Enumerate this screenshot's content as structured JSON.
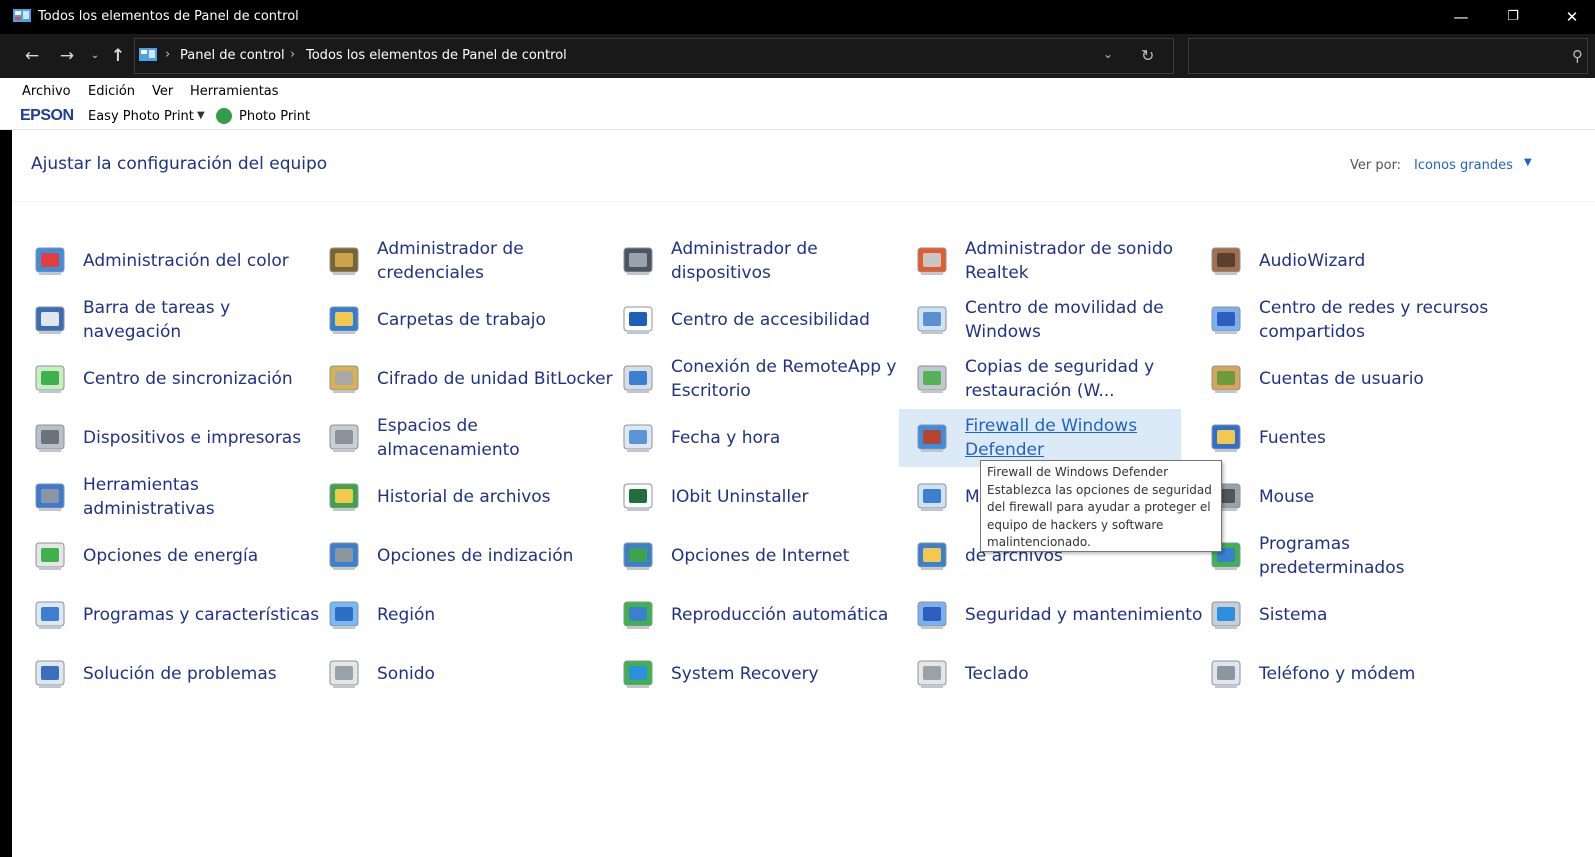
{
  "window": {
    "title": "Todos los elementos de Panel de control",
    "minimize_label": "—",
    "restore_label": "❐",
    "close_label": "✕"
  },
  "address": {
    "breadcrumbs": [
      "Panel de control",
      "Todos los elementos de Panel de control"
    ]
  },
  "menu": [
    "Archivo",
    "Edición",
    "Ver",
    "Herramientas"
  ],
  "epson": {
    "logo": "EPSON",
    "app": "Easy Photo Print",
    "photo_print": "Photo Print"
  },
  "header": {
    "title": "Ajustar la configuración del equipo",
    "view_by_label": "Ver por:",
    "view_by_value": "Iconos grandes"
  },
  "items": [
    {
      "label": "Administración del color",
      "icon": "color-management-icon"
    },
    {
      "label": "Administrador de credenciales",
      "icon": "credential-manager-icon"
    },
    {
      "label": "Administrador de dispositivos",
      "icon": "device-manager-icon"
    },
    {
      "label": "Administrador de sonido Realtek",
      "icon": "speaker-icon"
    },
    {
      "label": "AudioWizard",
      "icon": "audiowizard-icon"
    },
    {
      "label": "Barra de tareas y navegación",
      "icon": "taskbar-icon"
    },
    {
      "label": "Carpetas de trabajo",
      "icon": "work-folders-icon"
    },
    {
      "label": "Centro de accesibilidad",
      "icon": "accessibility-icon"
    },
    {
      "label": "Centro de movilidad de Windows",
      "icon": "mobility-center-icon"
    },
    {
      "label": "Centro de redes y recursos compartidos",
      "icon": "network-center-icon"
    },
    {
      "label": "Centro de sincronización",
      "icon": "sync-center-icon"
    },
    {
      "label": "Cifrado de unidad BitLocker",
      "icon": "bitlocker-icon"
    },
    {
      "label": "Conexión de RemoteApp y Escritorio",
      "icon": "remoteapp-icon"
    },
    {
      "label": "Copias de seguridad y restauración (W...",
      "icon": "backup-icon"
    },
    {
      "label": "Cuentas de usuario",
      "icon": "user-accounts-icon"
    },
    {
      "label": "Dispositivos e impresoras",
      "icon": "printer-icon"
    },
    {
      "label": "Espacios de almacenamiento",
      "icon": "storage-spaces-icon"
    },
    {
      "label": "Fecha y hora",
      "icon": "date-time-icon"
    },
    {
      "label": "Firewall de Windows Defender",
      "icon": "firewall-icon"
    },
    {
      "label": "Fuentes",
      "icon": "fonts-icon"
    },
    {
      "label": "Herramientas administrativas",
      "icon": "admin-tools-icon"
    },
    {
      "label": "Historial de archivos",
      "icon": "file-history-icon"
    },
    {
      "label": "IObit Uninstaller",
      "icon": "iobit-icon"
    },
    {
      "label": "M",
      "icon": "mail-icon"
    },
    {
      "label": "Mouse",
      "icon": "mouse-icon"
    },
    {
      "label": "Opciones de energía",
      "icon": "power-options-icon"
    },
    {
      "label": "Opciones de indización",
      "icon": "indexing-icon"
    },
    {
      "label": "Opciones de Internet",
      "icon": "internet-options-icon"
    },
    {
      "label": "de archivos",
      "icon": "explorer-options-icon"
    },
    {
      "label": "Programas predeterminados",
      "icon": "default-programs-icon"
    },
    {
      "label": "Programas y características",
      "icon": "programs-features-icon"
    },
    {
      "label": "Región",
      "icon": "region-icon"
    },
    {
      "label": "Reproducción automática",
      "icon": "autoplay-icon"
    },
    {
      "label": "Seguridad y mantenimiento",
      "icon": "security-flag-icon"
    },
    {
      "label": "Sistema",
      "icon": "system-icon"
    },
    {
      "label": "Solución de problemas",
      "icon": "troubleshooting-icon"
    },
    {
      "label": "Sonido",
      "icon": "sound-icon"
    },
    {
      "label": "System Recovery",
      "icon": "recovery-icon"
    },
    {
      "label": "Teclado",
      "icon": "keyboard-icon"
    },
    {
      "label": "Teléfono y módem",
      "icon": "phone-modem-icon"
    }
  ],
  "tooltip": {
    "title": "Firewall de Windows Defender",
    "description": "Establezca las opciones de seguridad del firewall para ayudar a proteger el equipo de hackers y software malintencionado."
  }
}
